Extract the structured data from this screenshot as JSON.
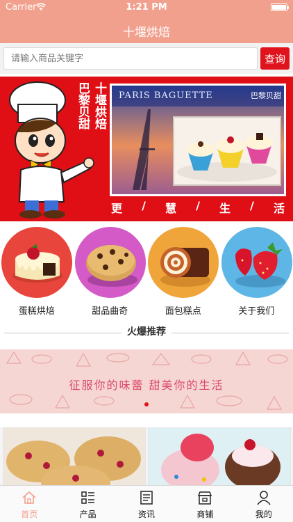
{
  "status_bar": {
    "carrier": "Carrier",
    "time": "1:21 PM"
  },
  "nav": {
    "title": "十堰烘焙"
  },
  "search": {
    "placeholder": "请输入商品关键字",
    "button_label": "查询"
  },
  "banner": {
    "vertical_text_1": "巴黎贝甜",
    "vertical_text_2": "十堰烘焙",
    "photo_heading": "PARIS BAGUETTE",
    "photo_heading_cn": "巴黎贝甜",
    "slogan": [
      "更",
      "/",
      "慧",
      "/",
      "生",
      "/",
      "活"
    ]
  },
  "categories": [
    {
      "label": "蛋糕烘焙",
      "icon": "cake-icon",
      "color": "#e8453c"
    },
    {
      "label": "甜品曲奇",
      "icon": "cookie-icon",
      "color": "#d45ac7"
    },
    {
      "label": "面包糕点",
      "icon": "swiss-roll-icon",
      "color": "#f0a53a"
    },
    {
      "label": "关于我们",
      "icon": "strawberry-icon",
      "color": "#5eb6e6"
    }
  ],
  "section": {
    "title": "火爆推荐"
  },
  "promo": {
    "text": "征服你的味蕾 甜美你的生活"
  },
  "tabbar": {
    "items": [
      {
        "label": "首页",
        "icon": "home-icon",
        "active": true
      },
      {
        "label": "产品",
        "icon": "grid-list-icon",
        "active": false
      },
      {
        "label": "资讯",
        "icon": "news-icon",
        "active": false
      },
      {
        "label": "商铺",
        "icon": "shop-icon",
        "active": false
      },
      {
        "label": "我的",
        "icon": "user-icon",
        "active": false
      }
    ]
  },
  "colors": {
    "header": "#f1a08d",
    "accent": "#e0141c",
    "banner_red": "#e00f16",
    "tab_active": "#f1a08d"
  }
}
